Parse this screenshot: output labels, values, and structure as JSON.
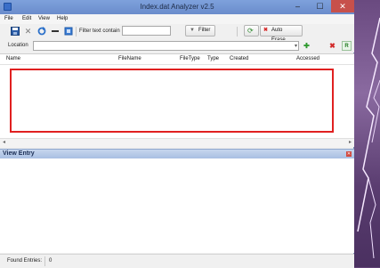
{
  "window": {
    "title": "Index.dat Analyzer v2.5",
    "controls": {
      "minimize": "‒",
      "maximize": "☐",
      "close": "✕"
    }
  },
  "menu": [
    "File",
    "Edit",
    "View",
    "Help"
  ],
  "toolbar": {
    "icons": [
      "save-icon",
      "delete-icon",
      "refresh-icon",
      "minus-icon",
      "export-icon"
    ],
    "filter_label": "Filter text contain",
    "filter_value": "",
    "filter_button": "Filter",
    "auto_erase_button": "Auto Erase..."
  },
  "location": {
    "label": "Location",
    "value": ""
  },
  "table": {
    "columns": [
      "Name",
      "FileName",
      "FileType",
      "Type",
      "Created",
      "Accessed"
    ],
    "rows": []
  },
  "view_entry": {
    "title": "View Entry"
  },
  "status": {
    "label": "Found Entries:",
    "value": "0"
  }
}
